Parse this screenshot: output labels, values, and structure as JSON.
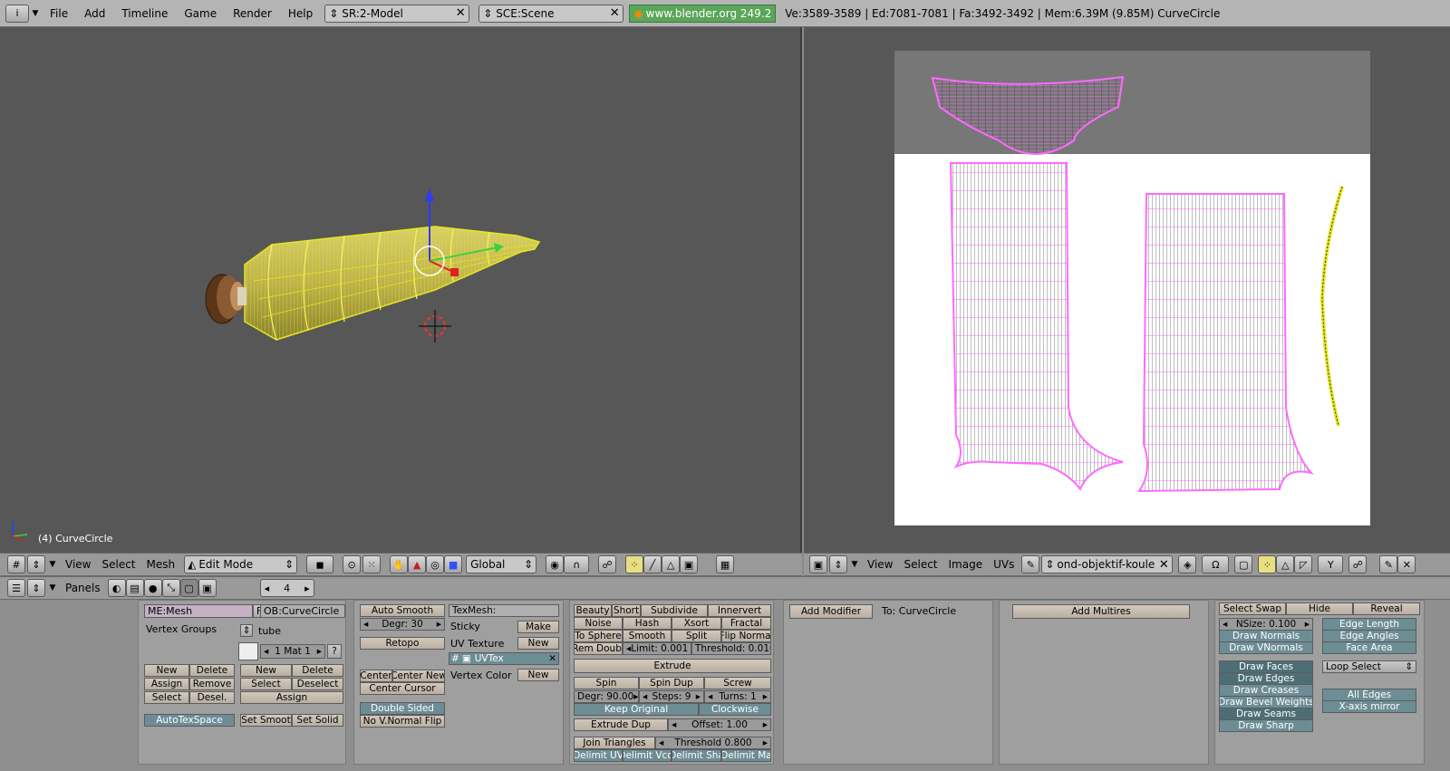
{
  "topbar": {
    "menus": [
      "File",
      "Add",
      "Timeline",
      "Game",
      "Render",
      "Help"
    ],
    "screen": "SR:2-Model",
    "scene": "SCE:Scene",
    "url": "www.blender.org 249.2",
    "stats": "Ve:3589-3589 | Ed:7081-7081 | Fa:3492-3492 | Mem:6.39M (9.85M) CurveCircle"
  },
  "view3d": {
    "object_label": "(4) CurveCircle",
    "menus": [
      "View",
      "Select",
      "Mesh"
    ],
    "mode": "Edit Mode",
    "orientation": "Global"
  },
  "uv": {
    "menus": [
      "View",
      "Select",
      "Image",
      "UVs"
    ],
    "image_name": "ond-objektif-kouleur"
  },
  "buttons": {
    "panels_label": "Panels",
    "frame": "4",
    "links": {
      "me": "ME:Mesh",
      "f": "F",
      "ob": "OB:CurveCircle",
      "vertex_groups": "Vertex Groups",
      "vg_name": "tube",
      "mat": "1 Mat 1",
      "q": "?",
      "new": "New",
      "delete": "Delete",
      "assign": "Assign",
      "remove": "Remove",
      "select": "Select",
      "desel": "Desel.",
      "new2": "New",
      "delete2": "Delete",
      "select2": "Select",
      "deselect": "Deselect",
      "assign2": "Assign",
      "autotex": "AutoTexSpace",
      "setsmooth": "Set Smoot",
      "setsolid": "Set Solid"
    },
    "mesh": {
      "autosmooth": "Auto Smooth",
      "degr": "Degr: 30",
      "retopo": "Retopo",
      "center": "Center",
      "centernew": "Center New",
      "centercursor": "Center Cursor",
      "doublesided": "Double Sided",
      "nonormalflip": "No V.Normal Flip",
      "texmesh": "TexMesh:",
      "sticky": "Sticky",
      "make": "Make",
      "uvtexture": "UV Texture",
      "new": "New",
      "uvtex": "UVTex",
      "vertexcolor": "Vertex Color",
      "new2": "New"
    },
    "tools": {
      "beauty": "Beauty",
      "short": "Short",
      "subdivide": "Subdivide",
      "innervert": "Innervert",
      "noise": "Noise",
      "hash": "Hash",
      "xsort": "Xsort",
      "fractal": "Fractal",
      "tosphere": "To Sphere",
      "smooth": "Smooth",
      "split": "Split",
      "flipnormal": "Flip Normal",
      "remdoubl": "Rem Doubl",
      "limit": "Limit: 0.001",
      "threshold": "Threshold: 0.010",
      "extrude": "Extrude",
      "spin": "Spin",
      "spindup": "Spin Dup",
      "screw": "Screw",
      "degr": "Degr: 90.00",
      "steps": "Steps: 9",
      "turns": "Turns: 1",
      "keeporiginal": "Keep Original",
      "clockwise": "Clockwise",
      "extrudedup": "Extrude Dup",
      "offset": "Offset: 1.00",
      "jointriangles": "Join Triangles",
      "threshold2": "Threshold 0.800",
      "delimituv": "Delimit UV",
      "delimitvcol": "Delimit Vcol",
      "delimitsha": "Delimit Sha",
      "delimitma": "Delimit Ma"
    },
    "modifiers": {
      "add": "Add Modifier",
      "to": "To: CurveCircle"
    },
    "multires": {
      "add": "Add Multires"
    },
    "more": {
      "selectswap": "Select Swap",
      "hide": "Hide",
      "reveal": "Reveal",
      "nsize": "NSize: 0.100",
      "drawnormals": "Draw Normals",
      "drawvnormals": "Draw VNormals",
      "edgelength": "Edge Length",
      "edgeangles": "Edge Angles",
      "facearea": "Face Area",
      "drawfaces": "Draw Faces",
      "drawedges": "Draw Edges",
      "drawcreases": "Draw Creases",
      "drawbevel": "Draw Bevel Weights",
      "drawseams": "Draw Seams",
      "drawsharp": "Draw Sharp",
      "loopselect": "Loop Select",
      "alledges": "All Edges",
      "xmirror": "X-axis mirror"
    }
  },
  "colors": {
    "wire": "#e6e61e",
    "uvwire": "#ff6aff",
    "bg": "#575757"
  }
}
